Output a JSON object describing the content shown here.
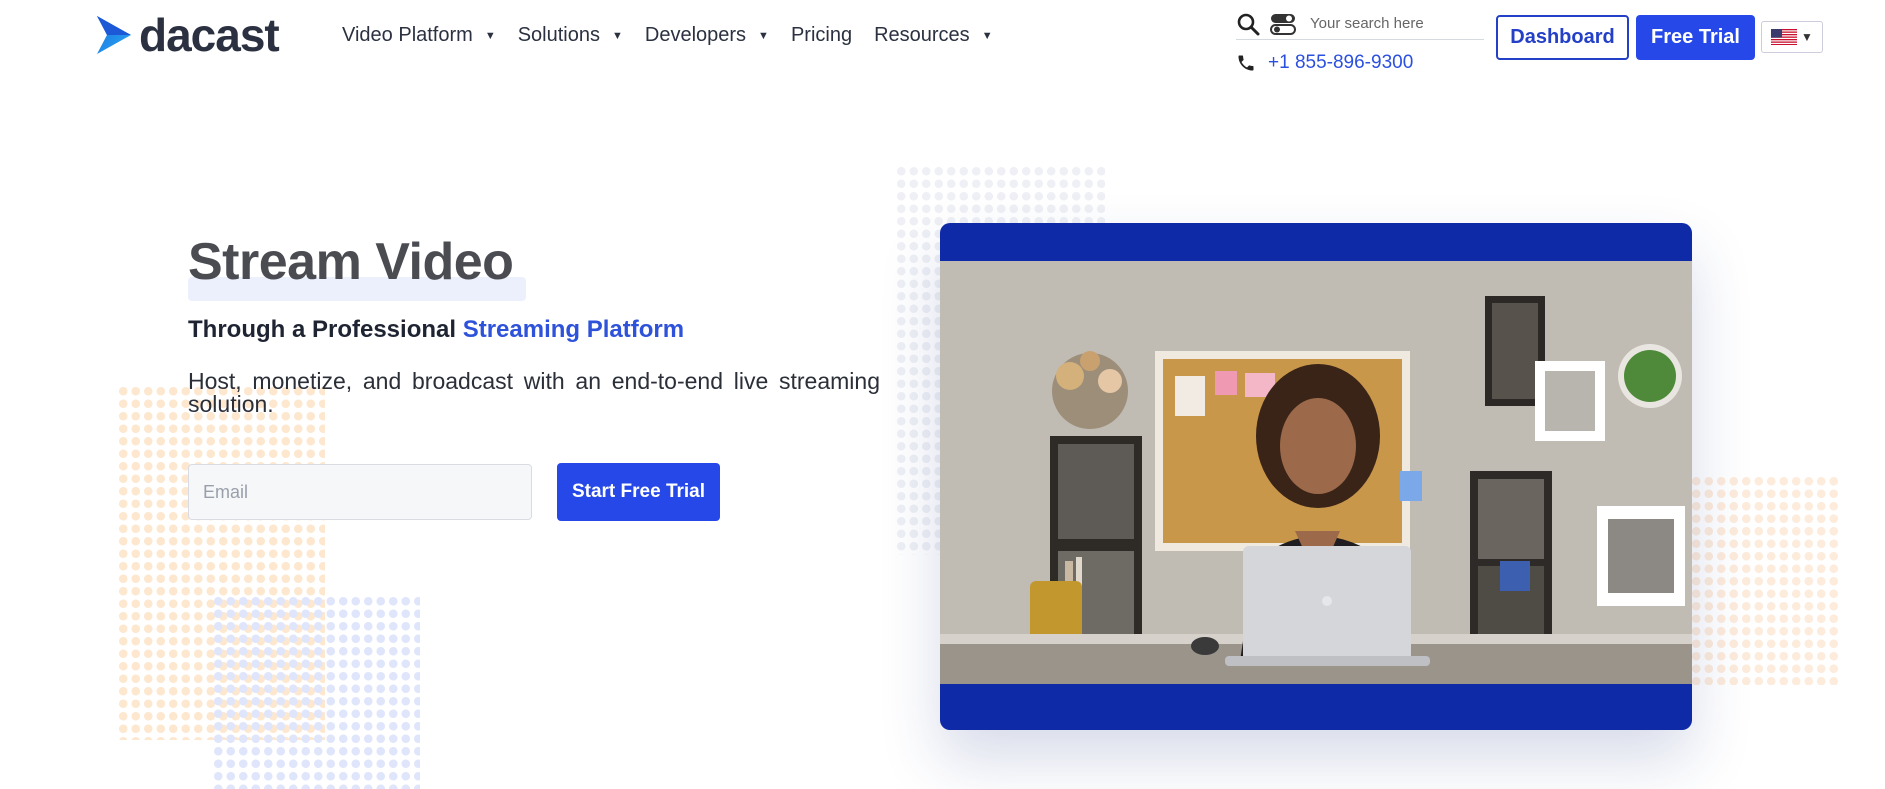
{
  "brand": {
    "name": "dacast"
  },
  "nav": {
    "items": [
      {
        "label": "Video Platform",
        "has_dropdown": true
      },
      {
        "label": "Solutions",
        "has_dropdown": true
      },
      {
        "label": "Developers",
        "has_dropdown": true
      },
      {
        "label": "Pricing",
        "has_dropdown": false
      },
      {
        "label": "Resources",
        "has_dropdown": true
      }
    ]
  },
  "search": {
    "placeholder": "Your search here"
  },
  "contact": {
    "phone": "+1 855-896-9300"
  },
  "header_buttons": {
    "dashboard": "Dashboard",
    "free_trial": "Free Trial"
  },
  "language": {
    "selected": "en-US",
    "icon": "us-flag-icon"
  },
  "hero": {
    "title": "Stream Video",
    "subtitle_prefix": "Through a Professional ",
    "subtitle_accent": "Streaming Platform",
    "description": "Host, monetize, and broadcast with an end-to-end live streaming solution.",
    "email_placeholder": "Email",
    "cta": "Start Free Trial"
  },
  "colors": {
    "accent": "#2648e8",
    "brand_dark": "#2b3140",
    "video_frame": "#0f2aa6",
    "link": "#2e52d9"
  }
}
